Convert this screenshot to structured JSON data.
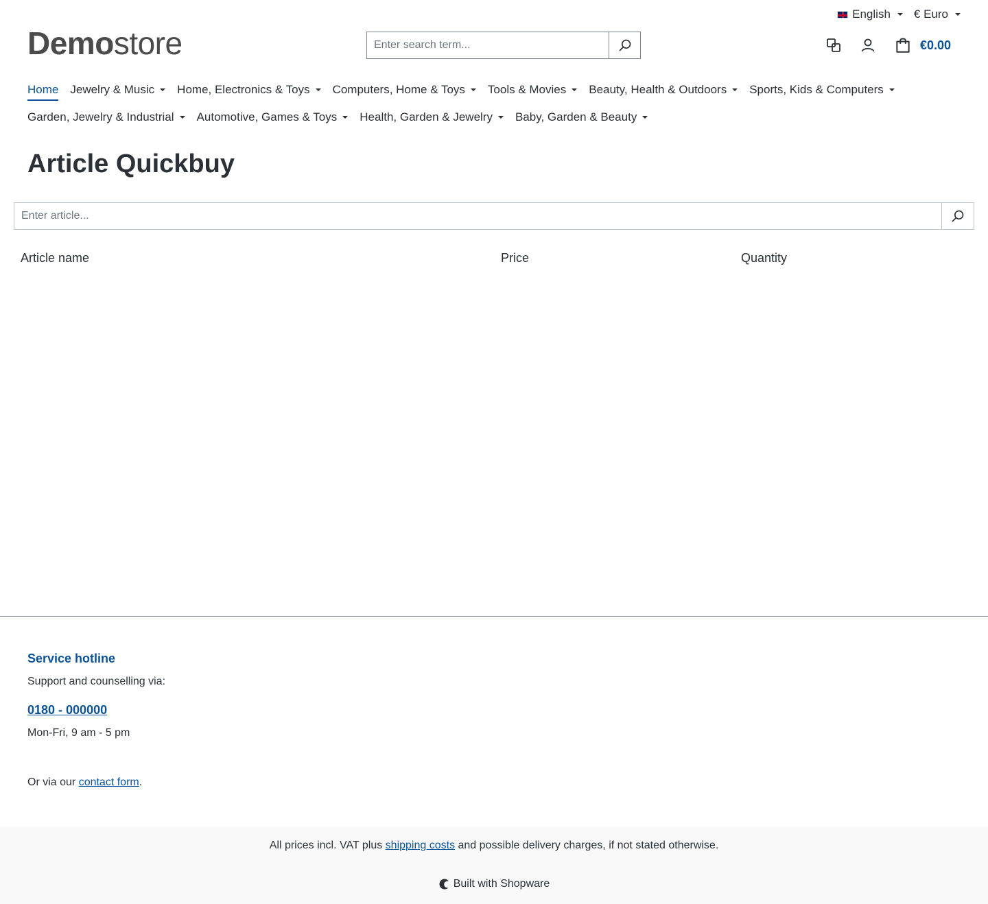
{
  "top_bar": {
    "language": "English",
    "currency": "€ Euro"
  },
  "header": {
    "logo_bold": "Demo",
    "logo_light": "store",
    "search_placeholder": "Enter search term...",
    "cart_total": "€0.00"
  },
  "nav": {
    "items": [
      {
        "label": "Home",
        "active": true,
        "dropdown": false
      },
      {
        "label": "Jewelry & Music",
        "dropdown": true
      },
      {
        "label": "Home, Electronics & Toys",
        "dropdown": true
      },
      {
        "label": "Computers, Home & Toys",
        "dropdown": true
      },
      {
        "label": "Tools & Movies",
        "dropdown": true
      },
      {
        "label": "Beauty, Health & Outdoors",
        "dropdown": true
      },
      {
        "label": "Sports, Kids & Computers",
        "dropdown": true
      },
      {
        "label": "Garden, Jewelry & Industrial",
        "dropdown": true
      },
      {
        "label": "Automotive, Games & Toys",
        "dropdown": true
      },
      {
        "label": "Health, Garden & Jewelry",
        "dropdown": true
      },
      {
        "label": "Baby, Garden & Beauty",
        "dropdown": true
      }
    ]
  },
  "main": {
    "title": "Article Quickbuy",
    "article_search_placeholder": "Enter article...",
    "columns": {
      "name": "Article name",
      "price": "Price",
      "quantity": "Quantity"
    }
  },
  "footer": {
    "hotline_title": "Service hotline",
    "hotline_sub": "Support and counselling via:",
    "phone": "0180 - 000000",
    "hours": "Mon-Fri, 9 am - 5 pm",
    "contact_prefix": "Or via our ",
    "contact_link": "contact form",
    "contact_suffix": ".",
    "vat_prefix": "All prices incl. VAT plus ",
    "vat_link": "shipping costs",
    "vat_suffix": " and possible delivery charges, if not stated otherwise.",
    "built_with": "Built with Shopware"
  },
  "colors": {
    "accent": "#0b539b",
    "text": "#2b3136",
    "border": "#798490"
  }
}
